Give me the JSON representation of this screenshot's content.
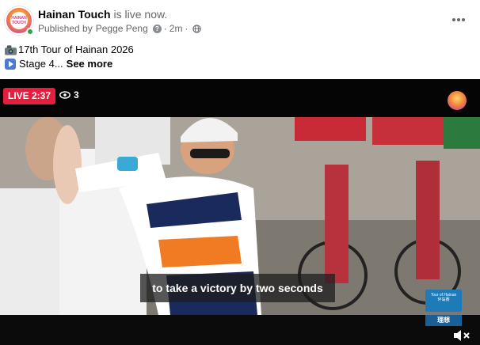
{
  "header": {
    "page_name": "Hainan Touch",
    "live_status": "is live now.",
    "published_by_prefix": "Published by",
    "publisher": "Pegge Peng",
    "info_icon": "info-icon",
    "time": "2m",
    "separator": "·",
    "audience_icon": "globe-icon",
    "more_icon": "more-options-icon",
    "avatar_text": "HAINAN TOUCH"
  },
  "post": {
    "line1_icon": "camera-emoji",
    "line1_text": "17th Tour of Hainan 2026",
    "line2_icon": "play-button-emoji",
    "line2_text": "Stage 4...",
    "see_more": "See more"
  },
  "video": {
    "live_badge": "LIVE 2:37",
    "viewer_count": "3",
    "viewer_icon": "eye-icon",
    "caption": "to take a victory by two seconds",
    "sponsor_top": "Tour of Hainan",
    "sponsor_top_cn": "环岛赛",
    "sponsor_bottom": "理想",
    "mute_icon": "speaker-muted-icon",
    "colors": {
      "live_red": "#e41e3f",
      "online_green": "#31a24c"
    }
  }
}
